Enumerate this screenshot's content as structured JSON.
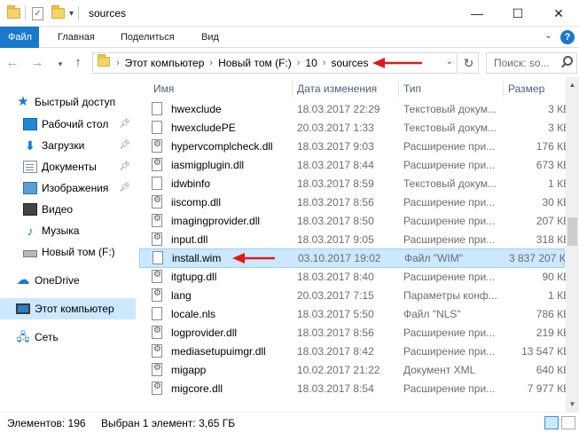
{
  "window": {
    "title": "sources",
    "minimize": "—",
    "maximize": "☐",
    "close": "✕"
  },
  "ribbon": {
    "tabs": [
      "Файл",
      "Главная",
      "Поделиться",
      "Вид"
    ],
    "collapse": "⌄",
    "help": "?"
  },
  "address": {
    "back": "←",
    "forward": "→",
    "up": "↑",
    "crumbs": [
      "Этот компьютер",
      "Новый том (F:)",
      "10",
      "sources"
    ],
    "dropdown": "⌄",
    "refresh": "↻",
    "search_placeholder": "Поиск: so..."
  },
  "nav": {
    "items": [
      {
        "label": "Быстрый доступ",
        "icon": "star-icon"
      },
      {
        "label": "Рабочий стол",
        "icon": "desktop-icon",
        "pinned": true
      },
      {
        "label": "Загрузки",
        "icon": "downloads-icon",
        "pinned": true
      },
      {
        "label": "Документы",
        "icon": "documents-icon",
        "pinned": true
      },
      {
        "label": "Изображения",
        "icon": "pictures-icon",
        "pinned": true
      },
      {
        "label": "Видео",
        "icon": "video-icon"
      },
      {
        "label": "Музыка",
        "icon": "music-icon"
      },
      {
        "label": "Новый том (F:)",
        "icon": "drive-icon"
      },
      {
        "label": "OneDrive",
        "icon": "onedrive-icon"
      },
      {
        "label": "Этот компьютер",
        "icon": "computer-icon",
        "selected": true
      },
      {
        "label": "Сеть",
        "icon": "network-icon"
      }
    ]
  },
  "columns": {
    "name": "Имя",
    "date": "Дата изменения",
    "type": "Тип",
    "size": "Размер"
  },
  "files": [
    {
      "name": "hwexclude",
      "date": "18.03.2017 22:29",
      "type": "Текстовый докум...",
      "size": "3 КБ",
      "icon": "text-file-icon"
    },
    {
      "name": "hwexcludePE",
      "date": "20.03.2017 1:33",
      "type": "Текстовый докум...",
      "size": "3 КБ",
      "icon": "text-file-icon"
    },
    {
      "name": "hypervcomplcheck.dll",
      "date": "18.03.2017 9:03",
      "type": "Расширение при...",
      "size": "176 КБ",
      "icon": "dll-file-icon"
    },
    {
      "name": "iasmigplugin.dll",
      "date": "18.03.2017 8:44",
      "type": "Расширение при...",
      "size": "673 КБ",
      "icon": "dll-file-icon"
    },
    {
      "name": "idwbinfo",
      "date": "18.03.2017 8:59",
      "type": "Текстовый докум...",
      "size": "1 КБ",
      "icon": "text-file-icon"
    },
    {
      "name": "iiscomp.dll",
      "date": "18.03.2017 8:56",
      "type": "Расширение при...",
      "size": "30 КБ",
      "icon": "dll-file-icon"
    },
    {
      "name": "imagingprovider.dll",
      "date": "18.03.2017 8:50",
      "type": "Расширение при...",
      "size": "207 КБ",
      "icon": "dll-file-icon"
    },
    {
      "name": "input.dll",
      "date": "18.03.2017 9:05",
      "type": "Расширение при...",
      "size": "318 КБ",
      "icon": "dll-file-icon"
    },
    {
      "name": "install.wim",
      "date": "03.10.2017 19:02",
      "type": "Файл \"WIM\"",
      "size": "3 837 207 КБ",
      "icon": "wim-file-icon",
      "selected": true
    },
    {
      "name": "itgtupg.dll",
      "date": "18.03.2017 8:40",
      "type": "Расширение при...",
      "size": "90 КБ",
      "icon": "dll-file-icon"
    },
    {
      "name": "lang",
      "date": "20.03.2017 7:15",
      "type": "Параметры конф...",
      "size": "1 КБ",
      "icon": "config-file-icon"
    },
    {
      "name": "locale.nls",
      "date": "18.03.2017 5:50",
      "type": "Файл \"NLS\"",
      "size": "786 КБ",
      "icon": "nls-file-icon"
    },
    {
      "name": "logprovider.dll",
      "date": "18.03.2017 8:56",
      "type": "Расширение при...",
      "size": "219 КБ",
      "icon": "dll-file-icon"
    },
    {
      "name": "mediasetupuimgr.dll",
      "date": "18.03.2017 8:42",
      "type": "Расширение при...",
      "size": "13 547 КБ",
      "icon": "dll-file-icon"
    },
    {
      "name": "migapp",
      "date": "10.02.2017 21:22",
      "type": "Документ XML",
      "size": "640 КБ",
      "icon": "xml-file-icon"
    },
    {
      "name": "migcore.dll",
      "date": "18.03.2017 8:54",
      "type": "Расширение при...",
      "size": "7 977 КБ",
      "icon": "dll-file-icon"
    }
  ],
  "status": {
    "count": "Элементов: 196",
    "selection": "Выбран 1 элемент: 3,65 ГБ"
  },
  "colors": {
    "accent": "#1979ca",
    "selection": "#cce8ff",
    "annotation": "#e01a1a"
  }
}
